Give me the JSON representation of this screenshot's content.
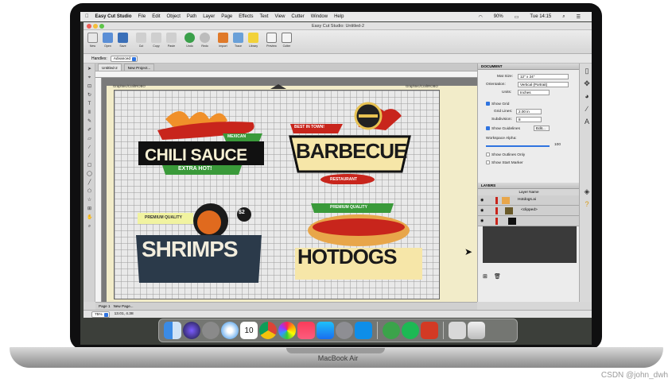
{
  "device": {
    "label": "MacBook Air",
    "watermark": "CSDN @john_dwh"
  },
  "menubar": {
    "apple": "",
    "items": [
      "Easy Cut Studio",
      "File",
      "Edit",
      "Object",
      "Path",
      "Layer",
      "Page",
      "Effects",
      "Text",
      "View",
      "Cutter",
      "Window",
      "Help"
    ],
    "battery": "90%",
    "clock": "Tue 14:15"
  },
  "window": {
    "title": "Easy Cut Studio: Untitled-2"
  },
  "toolbar": {
    "buttons": [
      "New",
      "Open",
      "Save",
      "Cut",
      "Copy",
      "Paste",
      "Undo",
      "Redo",
      "Import",
      "Trace",
      "Library",
      "Preview",
      "Cutter"
    ]
  },
  "options": {
    "handles_label": "Handles:",
    "handles_value": "Advanced"
  },
  "tabs": {
    "doc": "Untitled-2",
    "new": "New Project..."
  },
  "canvas": {
    "graphtec_left": "Graphtec/CraftROBO",
    "graphtec_right": "Graphtec/CraftROBO"
  },
  "artwork": {
    "chili_top": "MEXICAN",
    "chili_main": "CHILI SAUCE",
    "chili_sub": "EXTRA HOT!",
    "bbq_top": "BEST IN TOWN!",
    "bbq_main": "BARBECUE",
    "bbq_sub": "RESTAURANT",
    "shrimp_top": "PREMIUM QUALITY",
    "shrimp_main": "SHRIMPS",
    "shrimp_price": "$2",
    "hotdog_top": "PREMIUM QUALITY",
    "hotdog_main": "HOTDOGS"
  },
  "document_panel": {
    "header": "DOCUMENT",
    "mat_size_label": "Mat Size:",
    "mat_size_value": "12\" x 24\"",
    "orientation_label": "Orientation:",
    "orientation_value": "Vertical (Portrait)",
    "units_label": "Units:",
    "units_value": "Inches",
    "show_grid": "Show Grid",
    "grid_lines_label": "Grid Lines:",
    "grid_lines_value": "2.00 in",
    "subdivision_label": "Subdivision:",
    "subdivision_value": "8",
    "show_guidelines": "Show Guidelines",
    "edit_button": "Edit...",
    "workspace_alpha_label": "Workspace Alpha:",
    "workspace_alpha_value": "100",
    "show_outlines": "Show Outlines Only",
    "show_start_marker": "Show Start Marker"
  },
  "layers_panel": {
    "header": "LAYERS",
    "column": "Layer Name",
    "rows": [
      "Hotdogs.ai",
      "<clipped>",
      ""
    ]
  },
  "pagebar": {
    "page": "Page 1",
    "new_page": "New Page..."
  },
  "statusbar": {
    "zoom": "75%",
    "coords": "13.01, 4.38"
  },
  "colors": {
    "accent": "#2f74e0",
    "chili_red": "#c8251c",
    "green": "#3a9a3a",
    "yellow": "#f5d33b",
    "navy": "#2b3a4a"
  },
  "dock_icons": [
    "finder",
    "siri",
    "launchpad",
    "safari",
    "calendar",
    "chrome",
    "photos",
    "music",
    "app-store",
    "system-preferences",
    "teamviewer",
    "frog-app",
    "spotify",
    "maple-app",
    "keyboard-viewer",
    "trash"
  ],
  "dock_calendar_day": "10"
}
